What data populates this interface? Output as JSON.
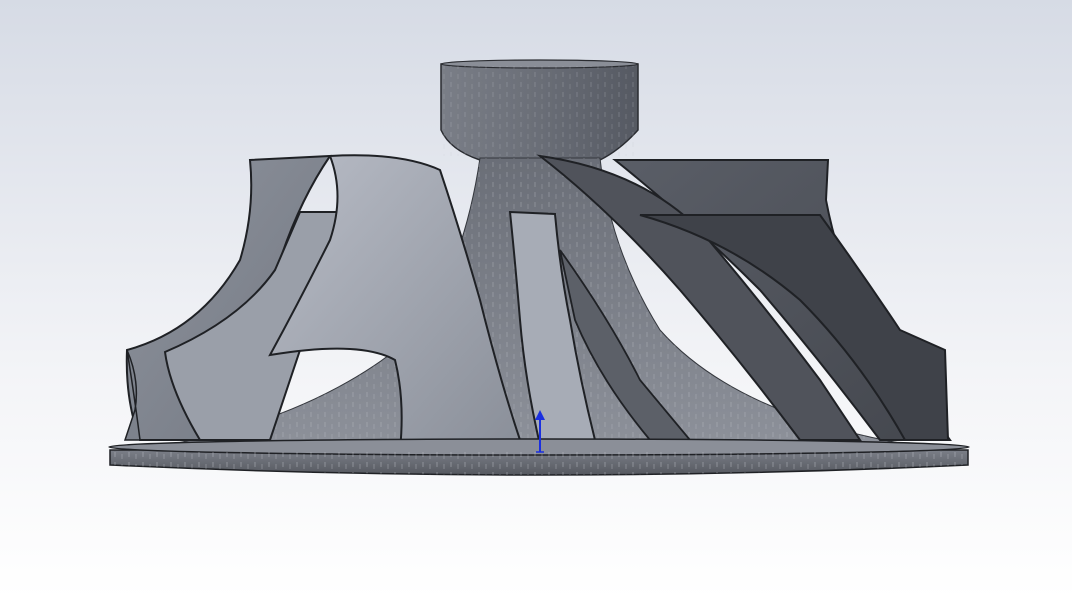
{
  "viewport": {
    "background_top": "#d6dbe5",
    "background_bottom": "#ffffff"
  },
  "model": {
    "part": "impeller",
    "blade_count": 12,
    "colors": {
      "hub": "#5c606a",
      "blade_light": "#9aa0ab",
      "blade_mid": "#7d828c",
      "blade_dark": "#4b4e56",
      "edge": "#1f2125",
      "base": "#6d717a",
      "triad_axis": "#1a2fe0"
    }
  },
  "triad": {
    "icon": "vertical-axis-arrow-icon"
  }
}
